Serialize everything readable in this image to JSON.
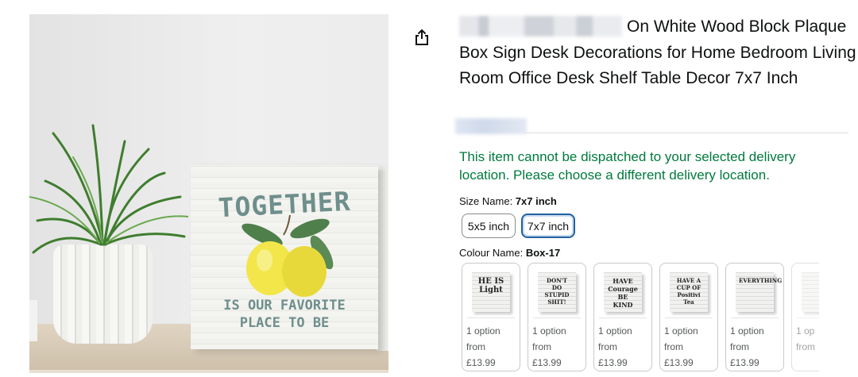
{
  "product": {
    "title_visible": "On White Wood Block Plaque Box Sign Desk Decorations for Home Bedroom Living Room Office Desk Shelf Table Decor 7x7 Inch",
    "image_text": {
      "top": "TOGETHER",
      "bottom_line1": "IS OUR FAVORITE",
      "bottom_line2": "PLACE TO BE"
    }
  },
  "icons": {
    "share": "share-icon"
  },
  "delivery": {
    "message": "This item cannot be dispatched to your selected delivery location. Please choose a different delivery location.",
    "color": "#007a3d"
  },
  "size": {
    "label": "Size Name:",
    "selected": "7x7 inch",
    "options": [
      "5x5 inch",
      "7x7 inch"
    ]
  },
  "colour": {
    "label": "Colour Name:",
    "selected": "Box-17",
    "swatches": [
      {
        "thumb_text": "HE IS Light",
        "line1": "1 option",
        "line2": "from",
        "price": "£13.99"
      },
      {
        "thumb_text": "DON'T DO STUPID SHIT!",
        "line1": "1 option",
        "line2": "from",
        "price": "£13.99"
      },
      {
        "thumb_text": "HAVE Courage BE KIND",
        "line1": "1 option",
        "line2": "from",
        "price": "£13.99"
      },
      {
        "thumb_text": "HAVE A CUP OF Positivi Tea",
        "line1": "1 option",
        "line2": "from",
        "price": "£13.99"
      },
      {
        "thumb_text": "EVERYTHING",
        "line1": "1 option",
        "line2": "from",
        "price": "£13.99"
      },
      {
        "thumb_text": "",
        "line1": "1 op",
        "line2": "from",
        "price": ""
      }
    ]
  },
  "colors": {
    "accent": "#2162a1",
    "border": "#888c8c",
    "text": "#0f1111"
  }
}
